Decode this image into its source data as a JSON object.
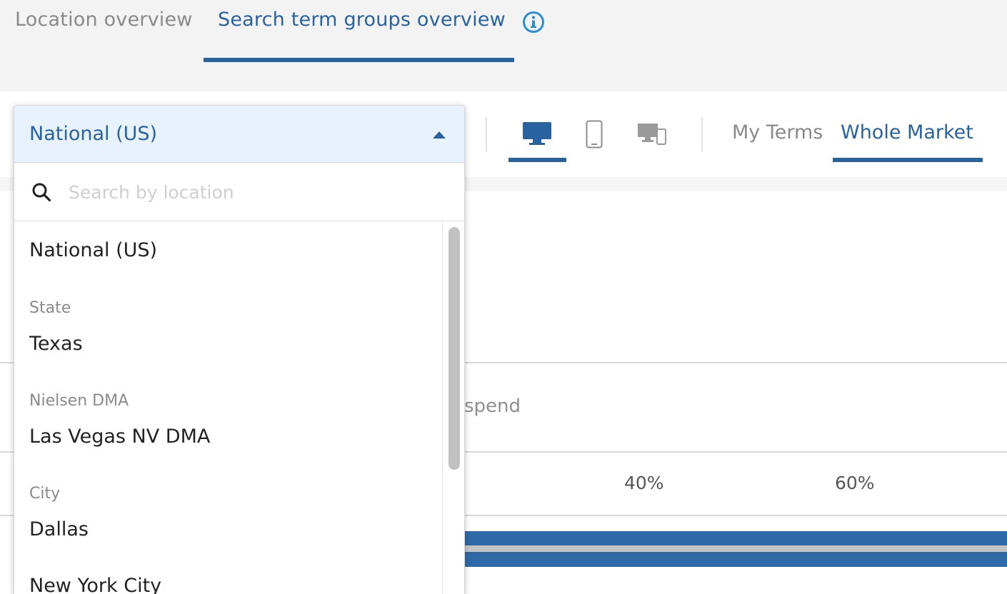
{
  "tabs": [
    {
      "label": "Location overview",
      "active": false
    },
    {
      "label": "Search term groups overview",
      "active": true
    }
  ],
  "icons": {
    "info": "info-icon",
    "desktop": "desktop-icon",
    "mobile": "mobile-icon",
    "all_devices": "multi-device-icon",
    "search": "search-icon",
    "caret": "caret-up-icon"
  },
  "device_toggle": {
    "selected": "desktop"
  },
  "scope_toggle": {
    "options": [
      "My Terms",
      "Whole Market"
    ],
    "selected": "Whole Market"
  },
  "location_dropdown": {
    "selected": "National (US)",
    "open": true,
    "search_placeholder": "Search by location",
    "search_value": "",
    "national": "National (US)",
    "groups": [
      {
        "label": "State",
        "items": [
          "Texas"
        ]
      },
      {
        "label": "Nielsen DMA",
        "items": [
          "Las Vegas NV DMA"
        ]
      },
      {
        "label": "City",
        "items": [
          "Dallas",
          "New York City"
        ]
      }
    ]
  },
  "background": {
    "partial_label": "spend",
    "ticks": [
      "40%",
      "60%"
    ]
  },
  "colors": {
    "accent": "#2862a0",
    "bar_blue": "#2f6aa7",
    "bar_gray": "#c4c4c4",
    "dropdown_header_bg": "#e8f2fc"
  }
}
